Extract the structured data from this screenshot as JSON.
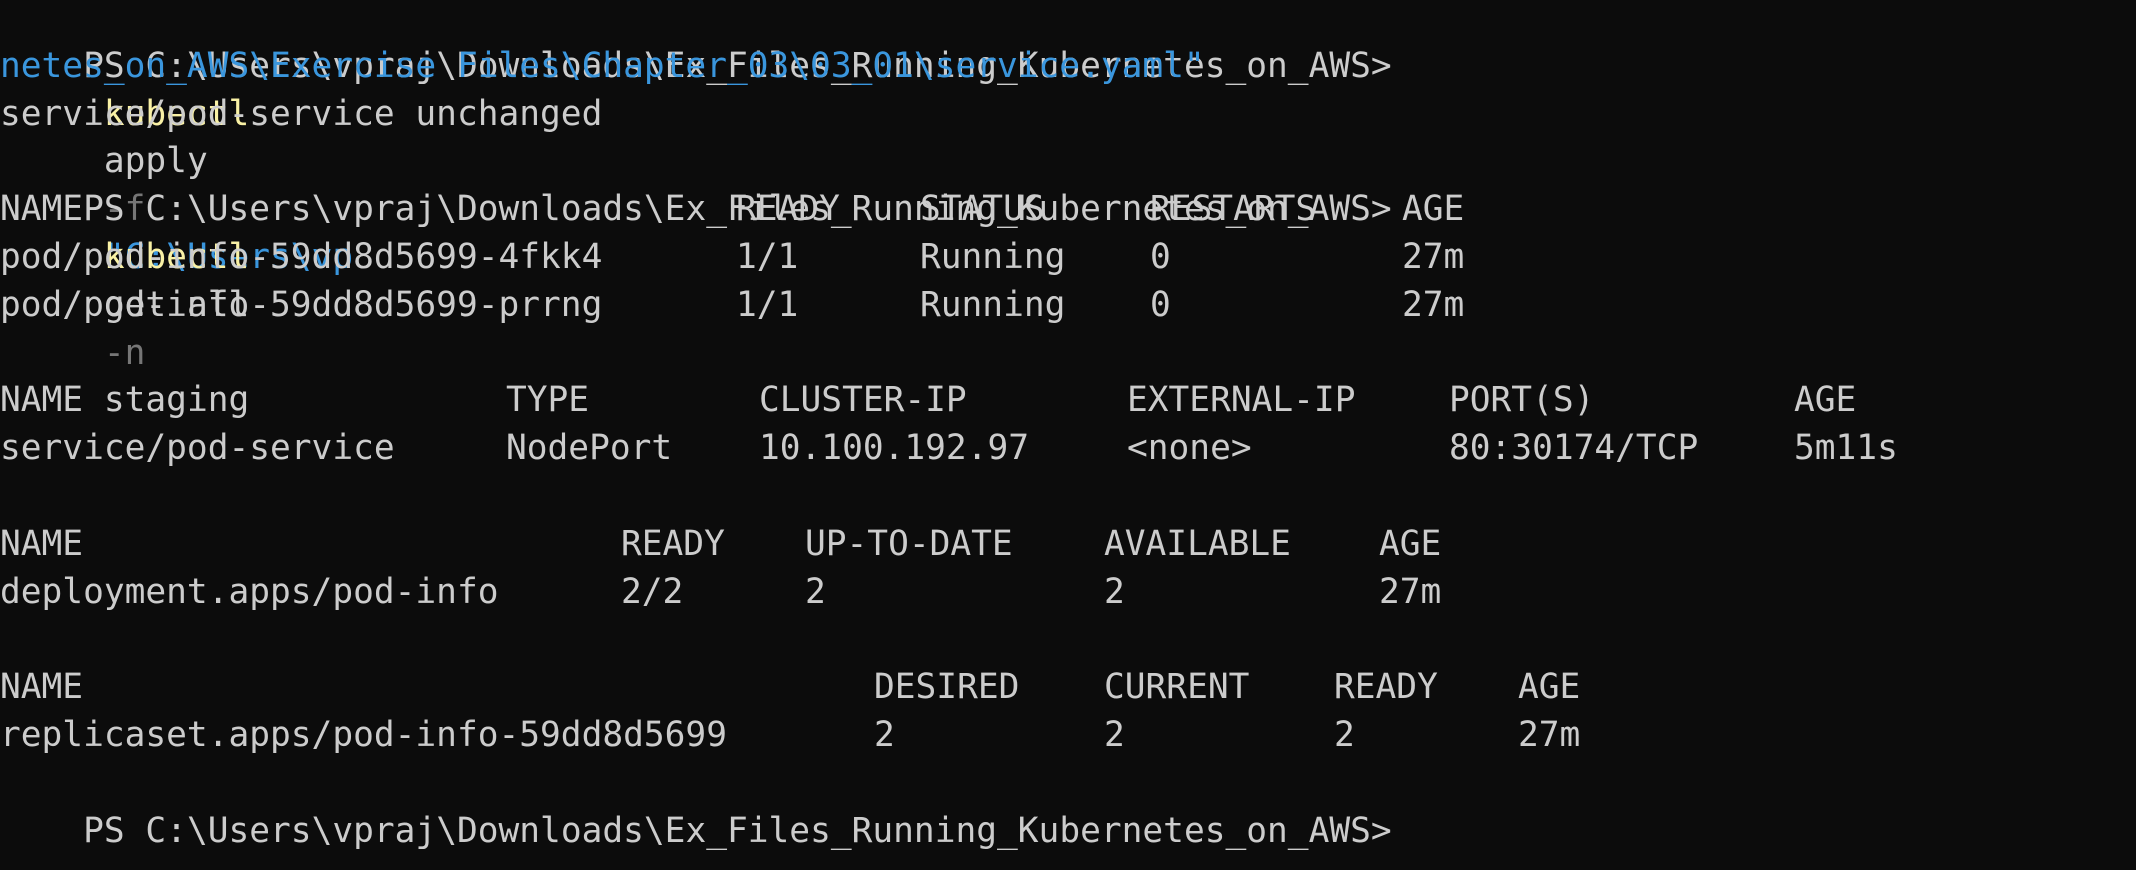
{
  "prompt": "PS C:\\Users\\vpraj\\Downloads\\Ex_Files_Running_Kubernetes_on_AWS>",
  "colors": {
    "background": "#0c0c0c",
    "text": "#cccccc",
    "command": "#f9f1a5",
    "flag": "#767676",
    "string": "#3a96dd"
  },
  "command1": {
    "program": "kubectl",
    "verb": "apply",
    "flag": "-f",
    "path_start": "\"C:\\Users\\vp",
    "path_wrap": "netes_on_AWS\\Exercise Files\\Chapter_03\\03_01\\service.yaml\""
  },
  "output1": "service/pod-service unchanged",
  "command2": {
    "program": "kubectl",
    "verb": "get all",
    "flag": "-n",
    "arg": "staging"
  },
  "pods": {
    "headers": [
      "NAME",
      "READY",
      "STATUS",
      "RESTARTS",
      "AGE"
    ],
    "rows": [
      [
        "pod/pod-info-59dd8d5699-4fkk4",
        "1/1",
        "Running",
        "0",
        "27m"
      ],
      [
        "pod/pod-info-59dd8d5699-prrng",
        "1/1",
        "Running",
        "0",
        "27m"
      ]
    ]
  },
  "services": {
    "headers": [
      "NAME",
      "TYPE",
      "CLUSTER-IP",
      "EXTERNAL-IP",
      "PORT(S)",
      "AGE"
    ],
    "rows": [
      [
        "service/pod-service",
        "NodePort",
        "10.100.192.97",
        "<none>",
        "80:30174/TCP",
        "5m11s"
      ]
    ]
  },
  "deployments": {
    "headers": [
      "NAME",
      "READY",
      "UP-TO-DATE",
      "AVAILABLE",
      "AGE"
    ],
    "rows": [
      [
        "deployment.apps/pod-info",
        "2/2",
        "2",
        "2",
        "27m"
      ]
    ]
  },
  "replicasets": {
    "headers": [
      "NAME",
      "DESIRED",
      "CURRENT",
      "READY",
      "AGE"
    ],
    "rows": [
      [
        "replicaset.apps/pod-info-59dd8d5699",
        "2",
        "2",
        "2",
        "27m"
      ]
    ]
  }
}
